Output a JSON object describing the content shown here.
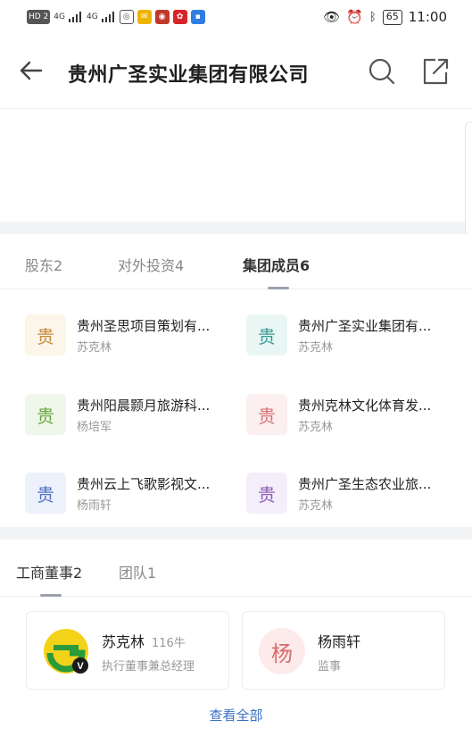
{
  "statusbar": {
    "left_tags": [
      "HD 2",
      "4G",
      "4G"
    ],
    "battery": "65",
    "time": "11:00"
  },
  "header": {
    "title": "贵州广圣实业集团有限公司"
  },
  "members_tabs": [
    {
      "label": "股东2",
      "active": false
    },
    {
      "label": "对外投资4",
      "active": false
    },
    {
      "label": "集团成员6",
      "active": true
    }
  ],
  "members": [
    {
      "avatar": "贵",
      "name": "贵州圣思项目策划有...",
      "person": "苏克林",
      "color": "#c98a3a",
      "bg": "#fbf5ea"
    },
    {
      "avatar": "贵",
      "name": "贵州广圣实业集团有...",
      "person": "苏克林",
      "color": "#3a9c94",
      "bg": "#e9f6f4"
    },
    {
      "avatar": "贵",
      "name": "贵州阳晨颢月旅游科...",
      "person": "杨培军",
      "color": "#6aa542",
      "bg": "#eff7ea"
    },
    {
      "avatar": "贵",
      "name": "贵州克林文化体育发...",
      "person": "苏克林",
      "color": "#d9737a",
      "bg": "#fcefef"
    },
    {
      "avatar": "贵",
      "name": "贵州云上飞歌影视文...",
      "person": "杨雨轩",
      "color": "#4f74c8",
      "bg": "#edf1fb"
    },
    {
      "avatar": "贵",
      "name": "贵州广圣生态农业旅...",
      "person": "苏克林",
      "color": "#8f5fb8",
      "bg": "#f4eefa"
    }
  ],
  "people_tabs": [
    {
      "label": "工商董事2",
      "active": true
    },
    {
      "label": "团队1",
      "active": false
    }
  ],
  "people": [
    {
      "name": "苏克林",
      "count": "116牛",
      "role": "执行董事兼总经理",
      "avatar": "logo"
    },
    {
      "name": "杨雨轩",
      "count": "",
      "role": "监事",
      "avatar": "杨"
    }
  ],
  "view_all": "查看全部"
}
